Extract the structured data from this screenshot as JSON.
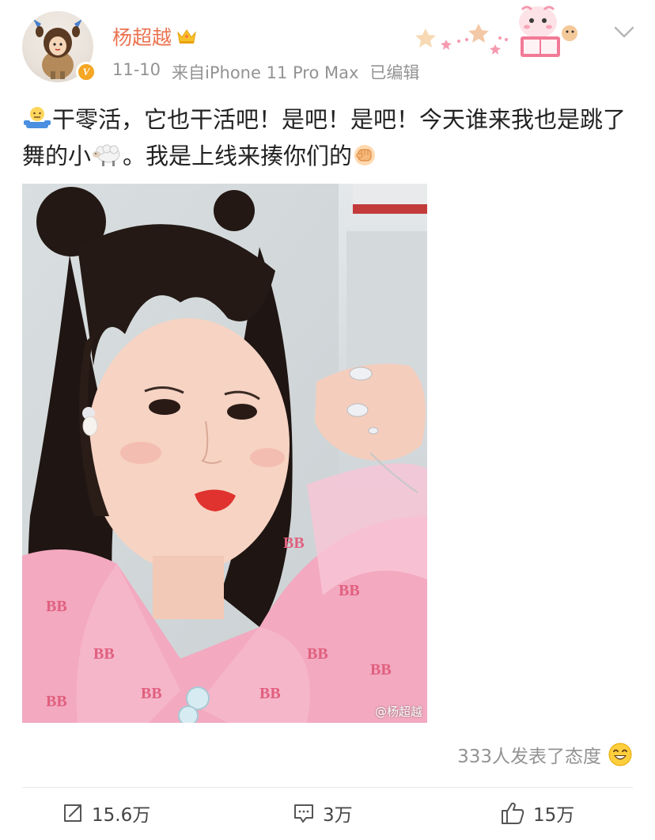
{
  "header": {
    "username": "杨超越",
    "date": "11-10",
    "source": "来自iPhone 11 Pro Max",
    "edited": "已编辑",
    "verified_badge": "V"
  },
  "post": {
    "text": "干零活，它也干活吧！是吧！是吧！今天谁来我也是跳了舞的小",
    "text_tail": "。我是上线来揍你们的",
    "emojis": [
      "worker-emoji",
      "sheep-emoji",
      "fist-emoji"
    ],
    "image_watermark": "@杨超越"
  },
  "reactions": {
    "summary": "333人发表了态度",
    "icon": "laughing-face-icon"
  },
  "actions": {
    "repost_count": "15.6万",
    "comment_count": "3万",
    "like_count": "15万"
  },
  "colors": {
    "username": "#eb7350",
    "meta": "#939393",
    "badge": "#f5a623"
  }
}
